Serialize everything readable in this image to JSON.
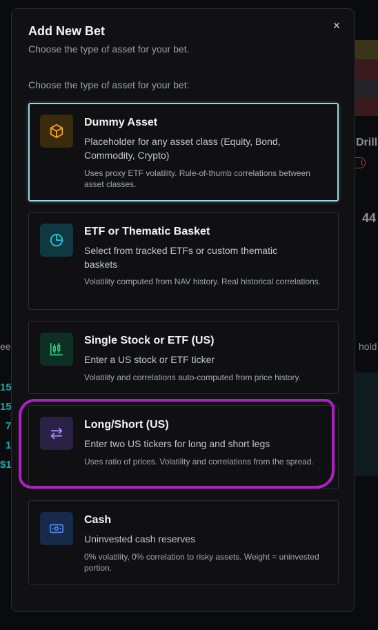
{
  "background": {
    "right_label": "Drill",
    "right_pill": "t",
    "right_number": "44",
    "left_text": "ee",
    "right_text": "hold",
    "numbers": [
      "15",
      "15",
      "7",
      "1",
      "$1"
    ]
  },
  "modal": {
    "title": "Add New Bet",
    "subtitle": "Choose the type of asset for your bet.",
    "close_label": "×",
    "section_label": "Choose the type of asset for your bet:",
    "options": [
      {
        "title": "Dummy Asset",
        "description": "Placeholder for any asset class (Equity, Bond, Commodity, Crypto)",
        "note": "Uses proxy ETF volatility. Rule-of-thumb correlations between asset classes.",
        "icon": "cube-icon",
        "accent": "#f5a524",
        "icon_bg": "#3a2a0e",
        "selected": true
      },
      {
        "title": "ETF or Thematic Basket",
        "description": "Select from tracked ETFs or custom thematic baskets",
        "note": "Volatility computed from NAV history. Real historical correlations.",
        "icon": "pie-chart-icon",
        "accent": "#22c8d8",
        "icon_bg": "#0f3840"
      },
      {
        "title": "Single Stock or ETF (US)",
        "description": "Enter a US stock or ETF ticker",
        "note": "Volatility and correlations auto-computed from price history.",
        "icon": "candlestick-icon",
        "accent": "#2fcf86",
        "icon_bg": "#0e3024"
      },
      {
        "title": "Long/Short (US)",
        "description": "Enter two US tickers for long and short legs",
        "note": "Uses ratio of prices. Volatility and correlations from the spread.",
        "icon": "arrows-swap-icon",
        "accent": "#a78bfa",
        "icon_bg": "#2a2145"
      },
      {
        "title": "Cash",
        "description": "Uninvested cash reserves",
        "note": "0% volatility, 0% correlation to risky assets. Weight = uninvested portion.",
        "icon": "banknote-icon",
        "accent": "#4f8df5",
        "icon_bg": "#182a4a"
      }
    ]
  },
  "colors": {
    "highlight": "#b01fc4",
    "selected_border": "#9ad6df"
  }
}
